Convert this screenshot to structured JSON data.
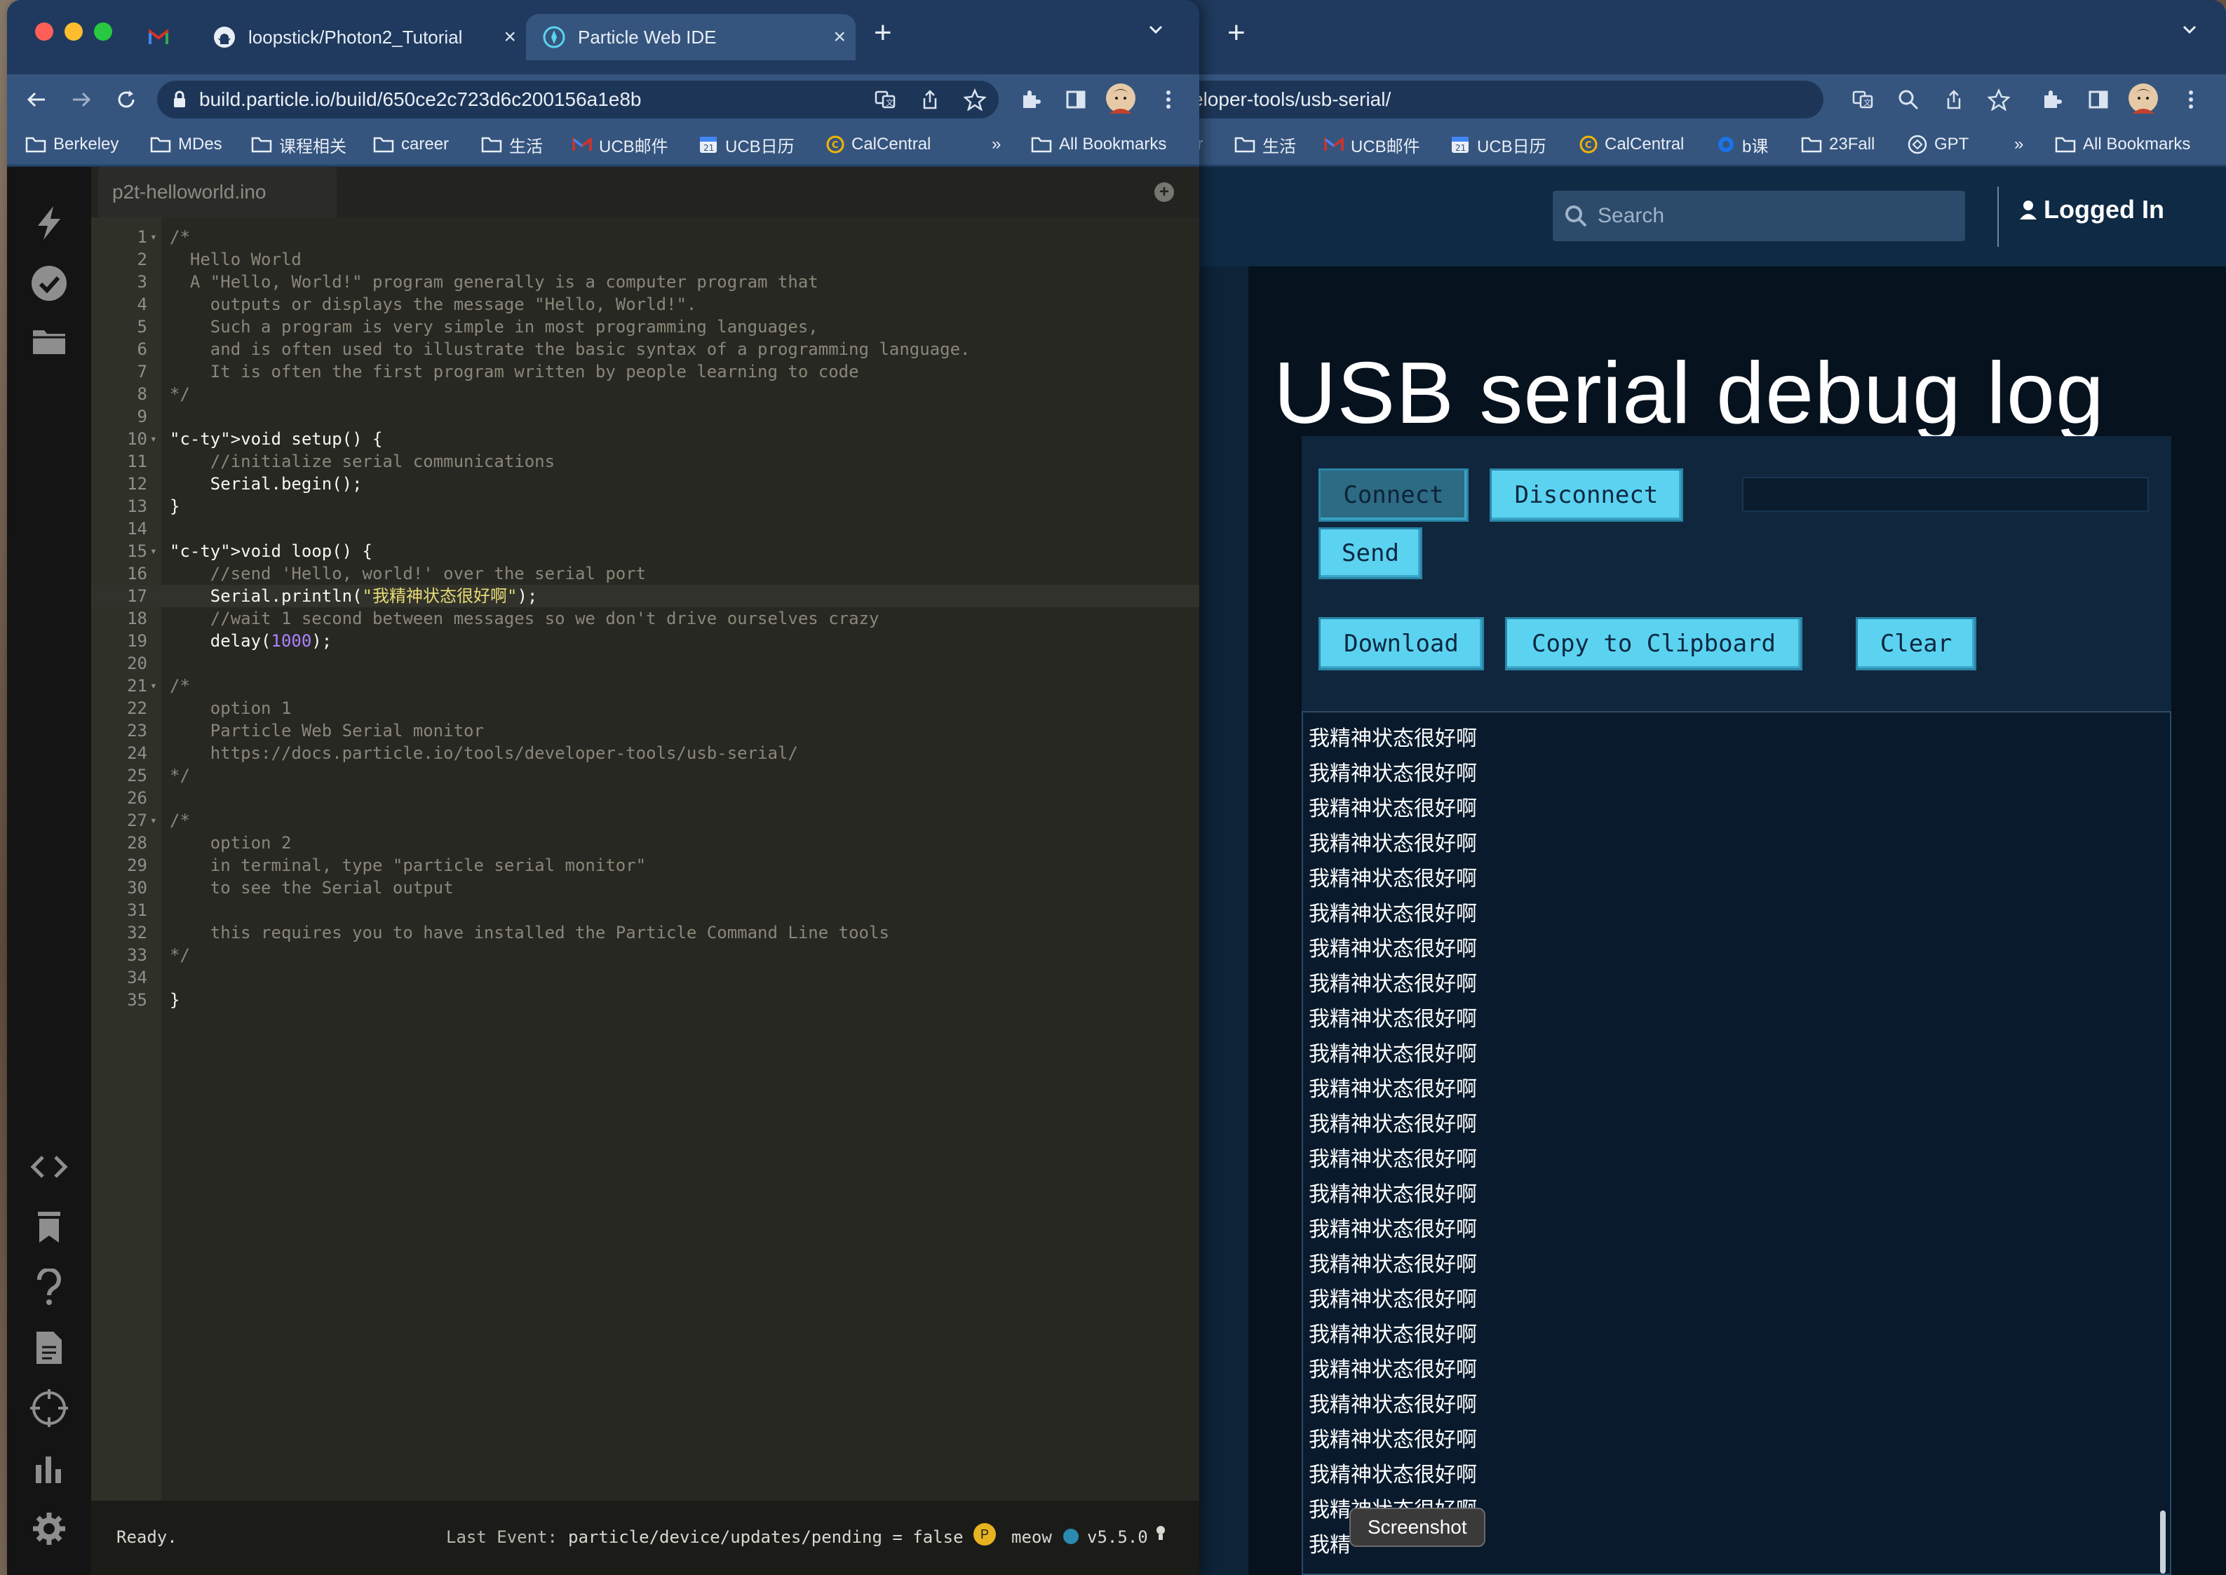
{
  "left_browser": {
    "tabs": [
      {
        "label": "",
        "icon": "gmail-icon"
      },
      {
        "label": "loopstick/Photon2_Tutorial",
        "icon": "github-icon"
      },
      {
        "label": "Particle Web IDE",
        "icon": "particle-icon",
        "active": true
      }
    ],
    "url": "build.particle.io/build/650ce2c723d6c200156a1e8b",
    "bookmarks": [
      "Berkeley",
      "MDes",
      "课程相关",
      "career",
      "生活",
      "UCB邮件",
      "UCB日历",
      "CalCentral"
    ],
    "bookmarks_overflow": "»",
    "all_bookmarks": "All Bookmarks"
  },
  "right_browser": {
    "url": "eloper-tools/usb-serial/",
    "bookmarks": [
      "er",
      "生活",
      "UCB邮件",
      "UCB日历",
      "CalCentral",
      "b课",
      "23Fall",
      "GPT"
    ],
    "bookmarks_overflow": "»",
    "all_bookmarks": "All Bookmarks"
  },
  "ide": {
    "file_tab": "p2t-helloworld.ino",
    "status_left": "Ready.",
    "last_event_label": "Last Event:",
    "last_event_value": "particle/device/updates/pending = false",
    "device_name": "meow",
    "device_badge": "P",
    "os_version": "v5.5.0",
    "code_lines": [
      "/*",
      "  Hello World",
      "  A \"Hello, World!\" program generally is a computer program that",
      "    outputs or displays the message \"Hello, World!\".",
      "    Such a program is very simple in most programming languages,",
      "    and is often used to illustrate the basic syntax of a programming language.",
      "    It is often the first program written by people learning to code",
      "*/",
      "",
      "void setup() {",
      "    //initialize serial communications",
      "    Serial.begin();",
      "}",
      "",
      "void loop() {",
      "    //send 'Hello, world!' over the serial port",
      "    Serial.println(\"我精神状态很好啊\");",
      "    //wait 1 second between messages so we don't drive ourselves crazy",
      "    delay(1000);",
      "",
      "/*",
      "    option 1",
      "    Particle Web Serial monitor",
      "    https://docs.particle.io/tools/developer-tools/usb-serial/",
      "*/",
      "",
      "/*",
      "    option 2",
      "    in terminal, type \"particle serial monitor\"",
      "    to see the Serial output",
      "",
      "    this requires you to have installed the Particle Command Line tools",
      "*/",
      "",
      "}"
    ]
  },
  "serial_page": {
    "search_placeholder": "Search",
    "logged_in": "Logged In",
    "title": "USB serial debug log",
    "buttons": {
      "connect": "Connect",
      "disconnect": "Disconnect",
      "send": "Send",
      "download": "Download",
      "copy": "Copy to Clipboard",
      "clear": "Clear"
    },
    "log_lines": [
      "我精神状态很好啊",
      "我精神状态很好啊",
      "我精神状态很好啊",
      "我精神状态很好啊",
      "我精神状态很好啊",
      "我精神状态很好啊",
      "我精神状态很好啊",
      "我精神状态很好啊",
      "我精神状态很好啊",
      "我精神状态很好啊",
      "我精神状态很好啊",
      "我精神状态很好啊",
      "我精神状态很好啊",
      "我精神状态很好啊",
      "我精神状态很好啊",
      "我精神状态很好啊",
      "我精神状态很好啊",
      "我精神状态很好啊",
      "我精神状态很好啊",
      "我精神状态很好啊",
      "我精神状态很好啊",
      "我精神状态很好啊",
      "我精神状态很好啊",
      "我精"
    ]
  },
  "tooltip": "Screenshot",
  "colors": {
    "accent_button": "#5bd3f0",
    "editor_bg": "#272822",
    "page_bg": "#06121e"
  }
}
